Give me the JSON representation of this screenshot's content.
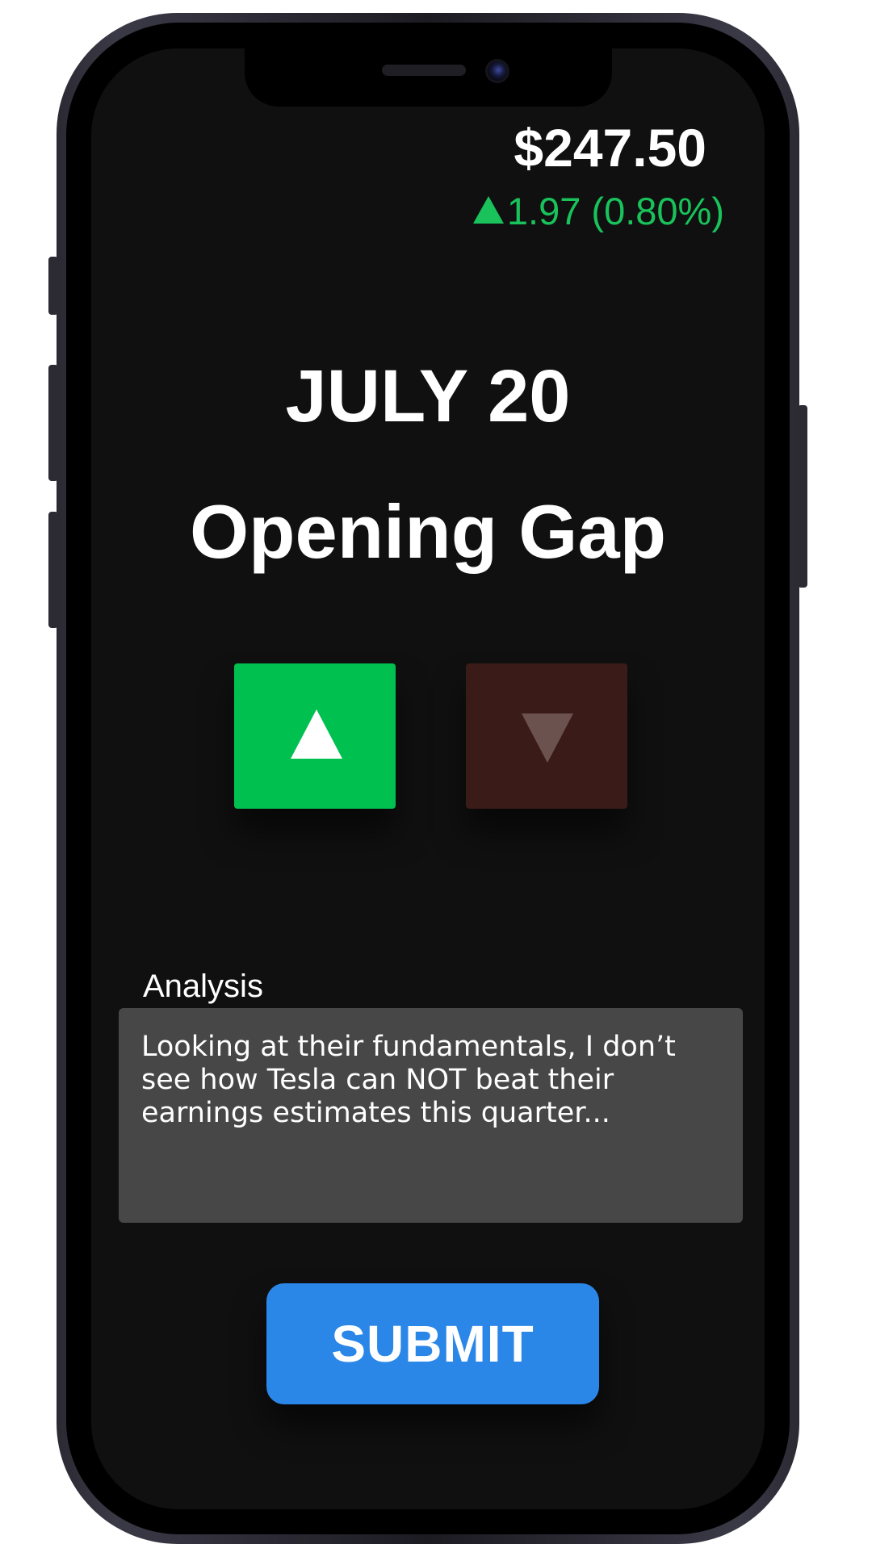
{
  "quote": {
    "price": "$247.50",
    "change": "1.97 (0.80%)",
    "direction_icon": "triangle-up-icon",
    "change_color": "#19c25b"
  },
  "prediction": {
    "date": "JULY 20",
    "title": "Opening Gap",
    "up_icon": "triangle-up-icon",
    "down_icon": "triangle-down-icon",
    "up_color": "#00c050",
    "down_color": "#3a1b18",
    "selected": "up"
  },
  "analysis": {
    "label": "Analysis",
    "value": "Looking at their fundamentals, I don’t see how Tesla can NOT beat their earnings estimates this quarter..."
  },
  "actions": {
    "submit_label": "SUBMIT",
    "submit_color": "#2a87e8"
  }
}
